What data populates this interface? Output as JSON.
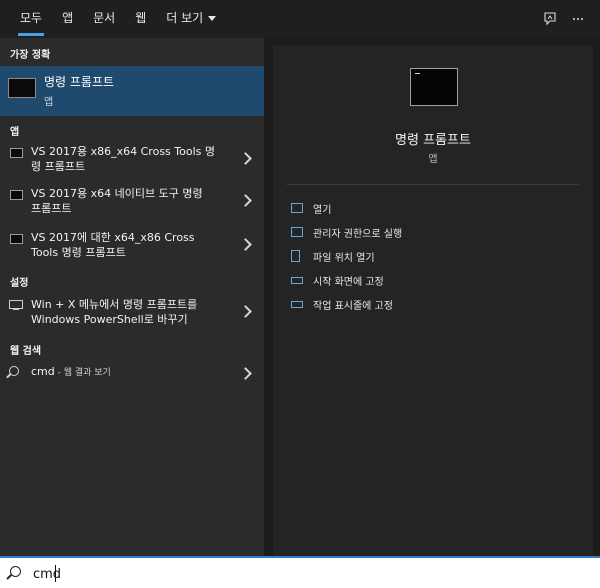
{
  "tabs": [
    {
      "label": "모두",
      "active": true
    },
    {
      "label": "앱"
    },
    {
      "label": "문서"
    },
    {
      "label": "웹"
    },
    {
      "label": "더 보기"
    }
  ],
  "top_icons": [
    "feedback-icon",
    "more-options-icon"
  ],
  "left_panel": {
    "best_match_heading": "가장 정확",
    "best_match": {
      "title": "명령 프롬프트",
      "subtitle": "앱"
    },
    "apps_heading": "앱",
    "apps": [
      {
        "line1": "VS 2017용 x86_x64 Cross Tools 명",
        "line2": "령 프롬프트"
      },
      {
        "line1": "VS 2017용 x64 네이티브 도구 명령",
        "line2": "프롬프트"
      },
      {
        "line1": "VS 2017에 대한 x64_x86 Cross",
        "line2": "Tools 명령 프롬프트"
      }
    ],
    "settings_heading": "설정",
    "settings": [
      {
        "line1": "Win + X 메뉴에서 명령 프롬프트를",
        "line2": "Windows PowerShell로 바꾸기"
      }
    ],
    "web_heading": "웹 검색",
    "web": {
      "query": "cmd",
      "suffix": " - 웹 결과 보기"
    }
  },
  "right_panel": {
    "title": "명령 프롬프트",
    "subtitle": "앱",
    "actions": [
      {
        "label": "열기",
        "icon": "open-icon"
      },
      {
        "label": "관리자 권한으로 실행",
        "icon": "run-as-admin-icon"
      },
      {
        "label": "파일 위치 열기",
        "icon": "file-location-icon"
      },
      {
        "label": "시작 화면에 고정",
        "icon": "pin-start-icon"
      },
      {
        "label": "작업 표시줄에 고정",
        "icon": "pin-taskbar-icon"
      }
    ]
  },
  "search": {
    "value": "cmd"
  },
  "colors": {
    "accent": "#2d7fd3",
    "selection": "#1f4a6e",
    "icon_blue": "#69a7df"
  }
}
